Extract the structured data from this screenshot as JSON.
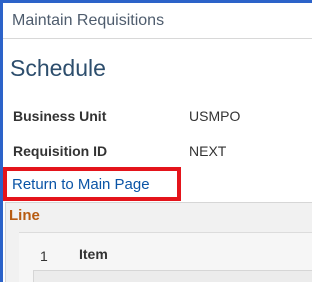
{
  "breadcrumb": "Maintain Requisitions",
  "page_title": "Schedule",
  "fields": {
    "business_unit": {
      "label": "Business Unit",
      "value": "USMPO"
    },
    "requisition_id": {
      "label": "Requisition ID",
      "value": "NEXT"
    }
  },
  "return_link": "Return to Main Page",
  "highlight_color": "#e4141b",
  "accent_color": "#2c63c9",
  "line_section": {
    "title": "Line",
    "rows": [
      {
        "number": "1",
        "column_label": "Item"
      }
    ]
  }
}
